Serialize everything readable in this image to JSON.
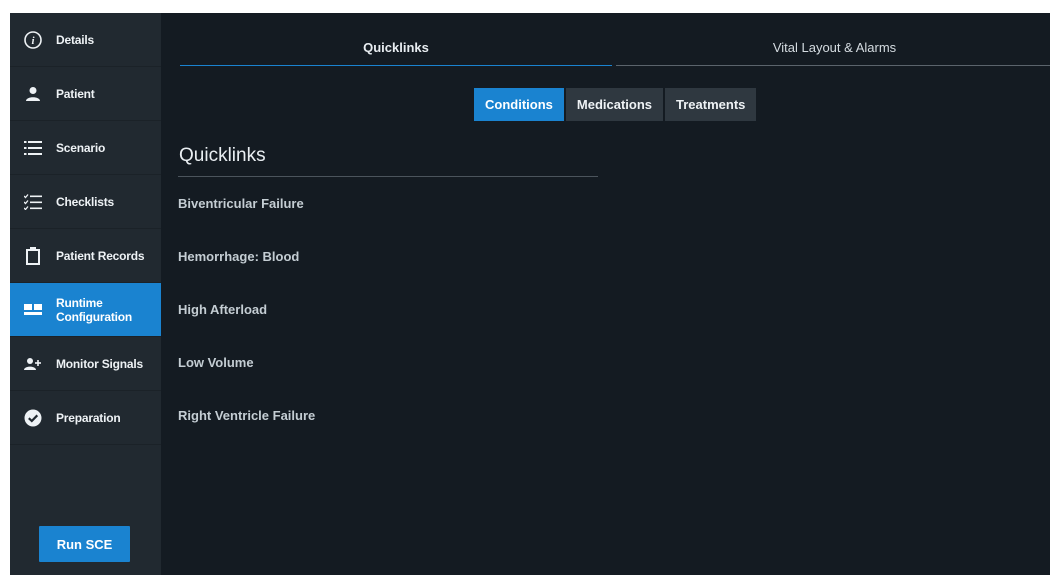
{
  "sidebar": {
    "items": [
      {
        "label": "Details",
        "icon": "info-icon",
        "active": false
      },
      {
        "label": "Patient",
        "icon": "person-icon",
        "active": false
      },
      {
        "label": "Scenario",
        "icon": "list-icon",
        "active": false
      },
      {
        "label": "Checklists",
        "icon": "checklist-icon",
        "active": false
      },
      {
        "label": "Patient Records",
        "icon": "clipboard-icon",
        "active": false
      },
      {
        "label": "Runtime Configuration",
        "icon": "dashboard-icon",
        "active": true
      },
      {
        "label": "Monitor Signals",
        "icon": "person-add-icon",
        "active": false
      },
      {
        "label": "Preparation",
        "icon": "check-circle-icon",
        "active": false
      }
    ],
    "run_button": "Run SCE"
  },
  "tabs": [
    {
      "label": "Quicklinks",
      "active": true
    },
    {
      "label": "Vital Layout & Alarms",
      "active": false
    }
  ],
  "subtabs": [
    {
      "label": "Conditions",
      "active": true
    },
    {
      "label": "Medications",
      "active": false
    },
    {
      "label": "Treatments",
      "active": false
    }
  ],
  "quicklinks": {
    "heading": "Quicklinks",
    "items": [
      "Biventricular Failure",
      "Hemorrhage: Blood",
      "High Afterload",
      "Low Volume",
      "Right Ventricle Failure"
    ]
  },
  "colors": {
    "accent": "#1a83d0",
    "sidebar_bg": "#212930",
    "main_bg": "#141b22"
  }
}
